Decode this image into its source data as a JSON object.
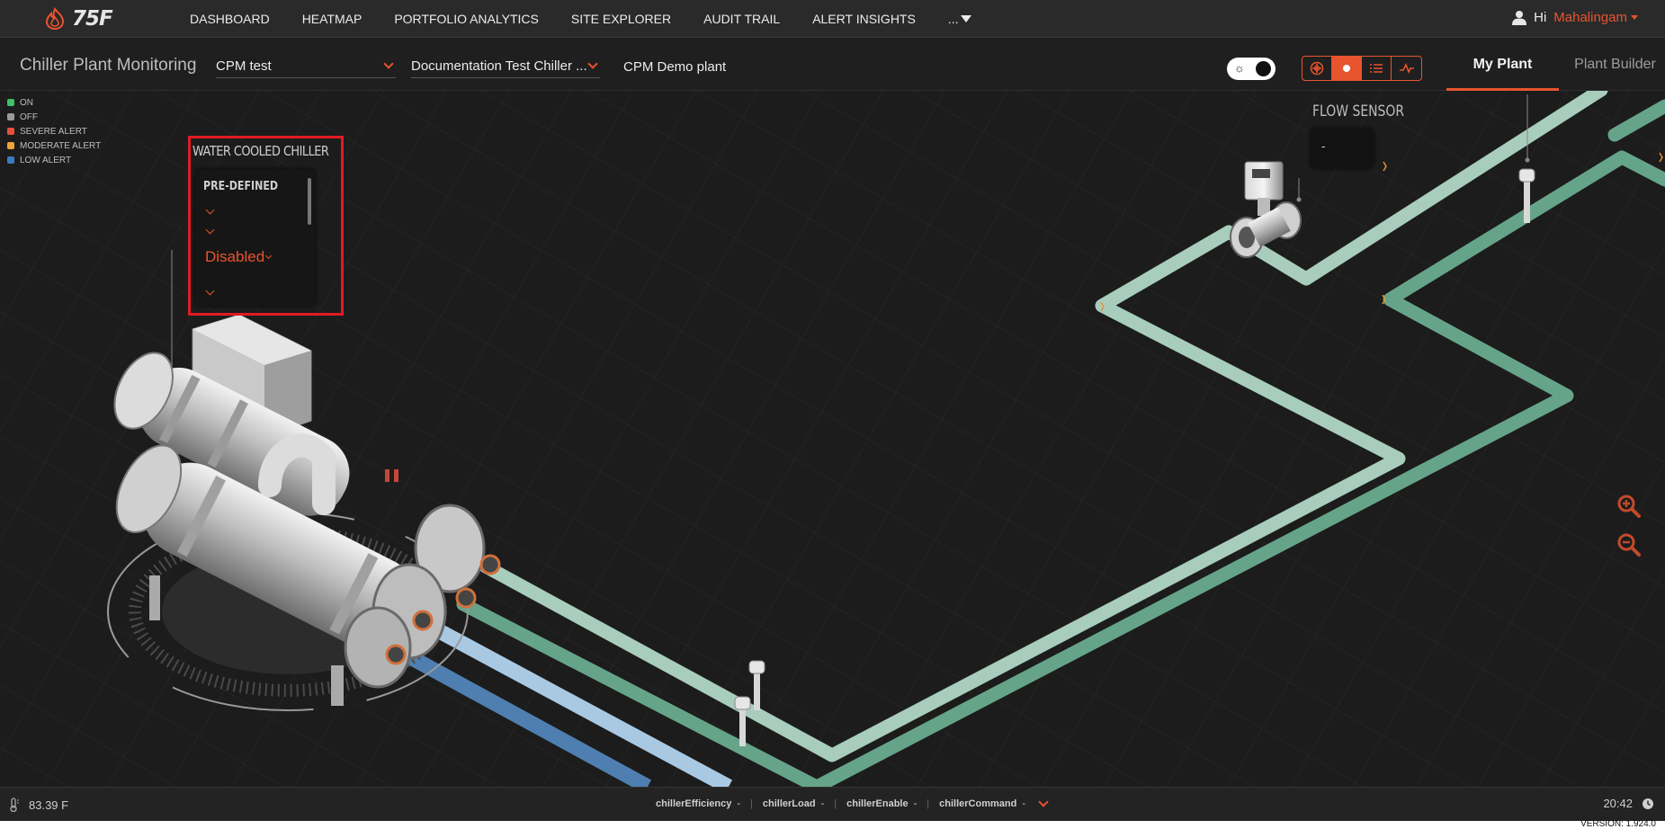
{
  "brand": {
    "logo_text": "75F"
  },
  "nav": {
    "items": [
      "DASHBOARD",
      "HEATMAP",
      "PORTFOLIO ANALYTICS",
      "SITE EXPLORER",
      "AUDIT TRAIL",
      "ALERT INSIGHTS"
    ],
    "more_label": "..."
  },
  "user": {
    "greeting": "Hi",
    "name": "Mahalingam"
  },
  "subheader": {
    "title": "Chiller Plant Monitoring",
    "site_select": "CPM test",
    "equip_select": "Documentation Test Chiller ...",
    "plant_name": "CPM Demo plant",
    "tabs": [
      "My Plant",
      "Plant Builder"
    ],
    "active_tab": "My Plant"
  },
  "legend": [
    {
      "label": "ON",
      "color": "#3cc167"
    },
    {
      "label": "OFF",
      "color": "#9a9a9a"
    },
    {
      "label": "SEVERE ALERT",
      "color": "#e8503a"
    },
    {
      "label": "MODERATE ALERT",
      "color": "#f0a33a"
    },
    {
      "label": "LOW ALERT",
      "color": "#3a7cc4"
    }
  ],
  "chiller_card": {
    "title": "WATER COOLED CHILLER",
    "section": "PRE-DEFINED",
    "value": "Disabled"
  },
  "flow_sensor": {
    "title": "FLOW SENSOR",
    "value": "-"
  },
  "footer": {
    "temperature": "83.39 F",
    "points": [
      {
        "name": "chillerEfficiency",
        "value": "-"
      },
      {
        "name": "chillerLoad",
        "value": "-"
      },
      {
        "name": "chillerEnable",
        "value": "-"
      },
      {
        "name": "chillerCommand",
        "value": "-"
      }
    ],
    "time": "20:42",
    "version": "VERSION: 1.924.0"
  },
  "colors": {
    "accent": "#e8542e",
    "highlight": "#e11b22",
    "pipe_light": "#a8cdbd",
    "pipe_green": "#66a48a",
    "pipe_lightblue": "#a9c9e3",
    "pipe_blue": "#4f7fb0"
  }
}
